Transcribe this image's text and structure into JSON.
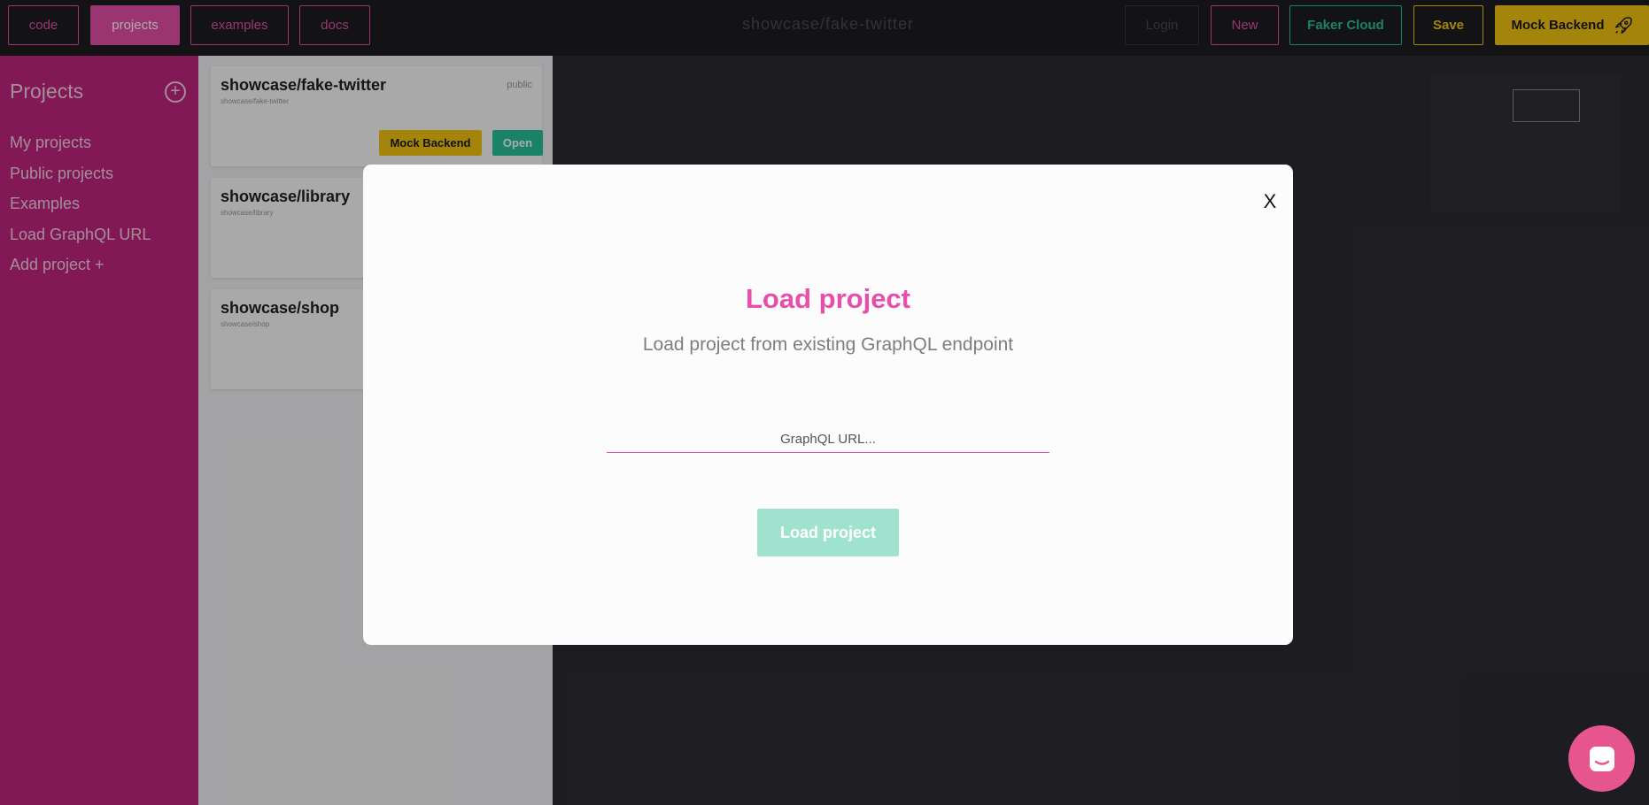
{
  "topbar": {
    "tabs": [
      {
        "label": "code",
        "active": false
      },
      {
        "label": "projects",
        "active": true
      },
      {
        "label": "examples",
        "active": false
      },
      {
        "label": "docs",
        "active": false
      }
    ],
    "project_title": "showcase/fake-twitter",
    "login_label": "Login",
    "new_label": "New",
    "faker_cloud_label": "Faker Cloud",
    "save_label": "Save",
    "mock_backend_label": "Mock Backend"
  },
  "sidebar": {
    "title": "Projects",
    "items": [
      {
        "label": "My projects"
      },
      {
        "label": "Public projects"
      },
      {
        "label": "Examples"
      },
      {
        "label": "Load GraphQL URL"
      },
      {
        "label": "Add project +"
      }
    ]
  },
  "projects": [
    {
      "name": "showcase/fake-twitter",
      "slug": "showcase/fake-twitter",
      "visibility": "public",
      "mock_label": "Mock Backend",
      "open_label": "Open"
    },
    {
      "name": "showcase/library",
      "slug": "showcase/library"
    },
    {
      "name": "showcase/shop",
      "slug": "showcase/shop"
    }
  ],
  "modal": {
    "close_label": "X",
    "title": "Load project",
    "subtitle": "Load project from existing GraphQL endpoint",
    "url_placeholder": "GraphQL URL...",
    "submit_label": "Load project"
  },
  "icons": {
    "add": "plus-circle-icon",
    "rocket": "rocket-icon",
    "chat": "chat-icon"
  },
  "colors": {
    "accent_pink": "#e84fab",
    "accent_green": "#26c29a",
    "accent_yellow": "#f5c50f",
    "sidebar_bg": "#c2247f"
  }
}
